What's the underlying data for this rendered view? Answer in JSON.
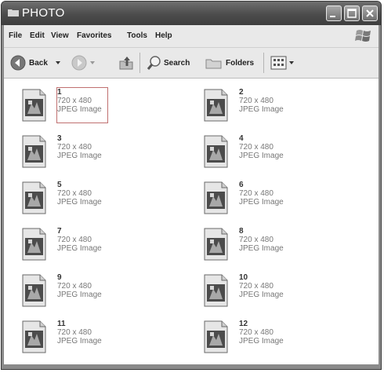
{
  "window": {
    "title": "PHOTO"
  },
  "menu": {
    "items": [
      "File",
      "Edit",
      "View",
      "Favorites",
      "Tools",
      "Help"
    ]
  },
  "toolbar": {
    "back_label": "Back",
    "search_label": "Search",
    "folders_label": "Folders"
  },
  "files": [
    {
      "name": "1",
      "dims": "720 x 480",
      "type": "JPEG Image",
      "selected": true
    },
    {
      "name": "2",
      "dims": "720 x 480",
      "type": "JPEG Image"
    },
    {
      "name": "3",
      "dims": "720 x 480",
      "type": "JPEG Image"
    },
    {
      "name": "4",
      "dims": "720 x 480",
      "type": "JPEG Image"
    },
    {
      "name": "5",
      "dims": "720 x 480",
      "type": "JPEG Image"
    },
    {
      "name": "6",
      "dims": "720 x 480",
      "type": "JPEG Image"
    },
    {
      "name": "7",
      "dims": "720 x 480",
      "type": "JPEG Image"
    },
    {
      "name": "8",
      "dims": "720 x 480",
      "type": "JPEG Image"
    },
    {
      "name": "9",
      "dims": "720 x 480",
      "type": "JPEG Image"
    },
    {
      "name": "10",
      "dims": "720 x 480",
      "type": "JPEG Image"
    },
    {
      "name": "11",
      "dims": "720 x 480",
      "type": "JPEG Image"
    },
    {
      "name": "12",
      "dims": "720 x 480",
      "type": "JPEG Image"
    }
  ]
}
